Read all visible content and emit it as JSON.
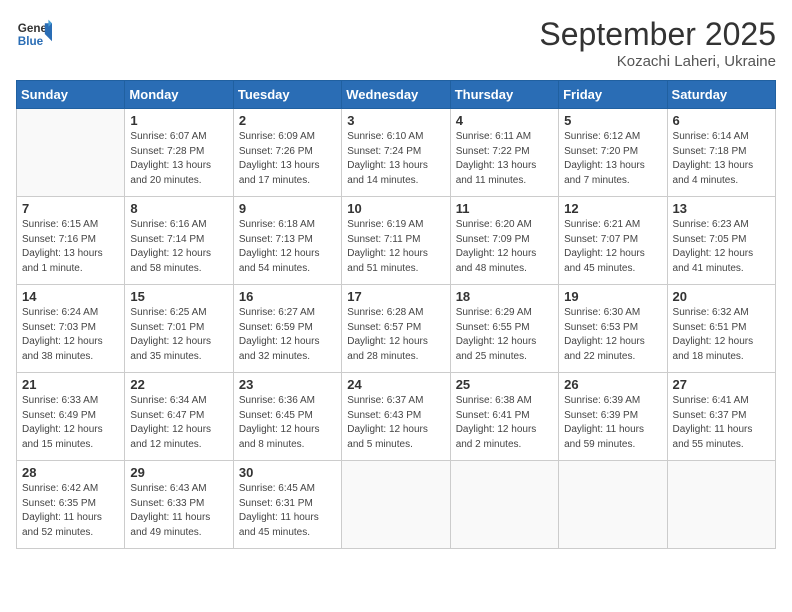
{
  "header": {
    "logo_general": "General",
    "logo_blue": "Blue",
    "month": "September 2025",
    "location": "Kozachi Laheri, Ukraine"
  },
  "weekdays": [
    "Sunday",
    "Monday",
    "Tuesday",
    "Wednesday",
    "Thursday",
    "Friday",
    "Saturday"
  ],
  "weeks": [
    [
      {
        "day": "",
        "info": ""
      },
      {
        "day": "1",
        "info": "Sunrise: 6:07 AM\nSunset: 7:28 PM\nDaylight: 13 hours\nand 20 minutes."
      },
      {
        "day": "2",
        "info": "Sunrise: 6:09 AM\nSunset: 7:26 PM\nDaylight: 13 hours\nand 17 minutes."
      },
      {
        "day": "3",
        "info": "Sunrise: 6:10 AM\nSunset: 7:24 PM\nDaylight: 13 hours\nand 14 minutes."
      },
      {
        "day": "4",
        "info": "Sunrise: 6:11 AM\nSunset: 7:22 PM\nDaylight: 13 hours\nand 11 minutes."
      },
      {
        "day": "5",
        "info": "Sunrise: 6:12 AM\nSunset: 7:20 PM\nDaylight: 13 hours\nand 7 minutes."
      },
      {
        "day": "6",
        "info": "Sunrise: 6:14 AM\nSunset: 7:18 PM\nDaylight: 13 hours\nand 4 minutes."
      }
    ],
    [
      {
        "day": "7",
        "info": "Sunrise: 6:15 AM\nSunset: 7:16 PM\nDaylight: 13 hours\nand 1 minute."
      },
      {
        "day": "8",
        "info": "Sunrise: 6:16 AM\nSunset: 7:14 PM\nDaylight: 12 hours\nand 58 minutes."
      },
      {
        "day": "9",
        "info": "Sunrise: 6:18 AM\nSunset: 7:13 PM\nDaylight: 12 hours\nand 54 minutes."
      },
      {
        "day": "10",
        "info": "Sunrise: 6:19 AM\nSunset: 7:11 PM\nDaylight: 12 hours\nand 51 minutes."
      },
      {
        "day": "11",
        "info": "Sunrise: 6:20 AM\nSunset: 7:09 PM\nDaylight: 12 hours\nand 48 minutes."
      },
      {
        "day": "12",
        "info": "Sunrise: 6:21 AM\nSunset: 7:07 PM\nDaylight: 12 hours\nand 45 minutes."
      },
      {
        "day": "13",
        "info": "Sunrise: 6:23 AM\nSunset: 7:05 PM\nDaylight: 12 hours\nand 41 minutes."
      }
    ],
    [
      {
        "day": "14",
        "info": "Sunrise: 6:24 AM\nSunset: 7:03 PM\nDaylight: 12 hours\nand 38 minutes."
      },
      {
        "day": "15",
        "info": "Sunrise: 6:25 AM\nSunset: 7:01 PM\nDaylight: 12 hours\nand 35 minutes."
      },
      {
        "day": "16",
        "info": "Sunrise: 6:27 AM\nSunset: 6:59 PM\nDaylight: 12 hours\nand 32 minutes."
      },
      {
        "day": "17",
        "info": "Sunrise: 6:28 AM\nSunset: 6:57 PM\nDaylight: 12 hours\nand 28 minutes."
      },
      {
        "day": "18",
        "info": "Sunrise: 6:29 AM\nSunset: 6:55 PM\nDaylight: 12 hours\nand 25 minutes."
      },
      {
        "day": "19",
        "info": "Sunrise: 6:30 AM\nSunset: 6:53 PM\nDaylight: 12 hours\nand 22 minutes."
      },
      {
        "day": "20",
        "info": "Sunrise: 6:32 AM\nSunset: 6:51 PM\nDaylight: 12 hours\nand 18 minutes."
      }
    ],
    [
      {
        "day": "21",
        "info": "Sunrise: 6:33 AM\nSunset: 6:49 PM\nDaylight: 12 hours\nand 15 minutes."
      },
      {
        "day": "22",
        "info": "Sunrise: 6:34 AM\nSunset: 6:47 PM\nDaylight: 12 hours\nand 12 minutes."
      },
      {
        "day": "23",
        "info": "Sunrise: 6:36 AM\nSunset: 6:45 PM\nDaylight: 12 hours\nand 8 minutes."
      },
      {
        "day": "24",
        "info": "Sunrise: 6:37 AM\nSunset: 6:43 PM\nDaylight: 12 hours\nand 5 minutes."
      },
      {
        "day": "25",
        "info": "Sunrise: 6:38 AM\nSunset: 6:41 PM\nDaylight: 12 hours\nand 2 minutes."
      },
      {
        "day": "26",
        "info": "Sunrise: 6:39 AM\nSunset: 6:39 PM\nDaylight: 11 hours\nand 59 minutes."
      },
      {
        "day": "27",
        "info": "Sunrise: 6:41 AM\nSunset: 6:37 PM\nDaylight: 11 hours\nand 55 minutes."
      }
    ],
    [
      {
        "day": "28",
        "info": "Sunrise: 6:42 AM\nSunset: 6:35 PM\nDaylight: 11 hours\nand 52 minutes."
      },
      {
        "day": "29",
        "info": "Sunrise: 6:43 AM\nSunset: 6:33 PM\nDaylight: 11 hours\nand 49 minutes."
      },
      {
        "day": "30",
        "info": "Sunrise: 6:45 AM\nSunset: 6:31 PM\nDaylight: 11 hours\nand 45 minutes."
      },
      {
        "day": "",
        "info": ""
      },
      {
        "day": "",
        "info": ""
      },
      {
        "day": "",
        "info": ""
      },
      {
        "day": "",
        "info": ""
      }
    ]
  ]
}
